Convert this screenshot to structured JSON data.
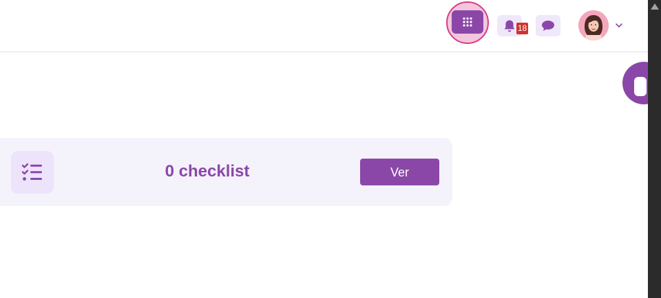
{
  "header": {
    "notifications_count": "18",
    "icons": {
      "apps": "apps-grid-icon",
      "notifications": "bell-icon",
      "messages": "chat-bubble-icon",
      "avatar": "user-avatar",
      "menu": "chevron-down-icon"
    }
  },
  "card": {
    "title": "0 checklist",
    "button_label": "Ver",
    "icon": "checklist-icon"
  },
  "colors": {
    "accent": "#8b47a8",
    "accent_light": "#efe7fa",
    "highlight_ring": "#d63d86",
    "highlight_fill": "#f3c6dc",
    "badge": "#d0332e",
    "card_bg": "#f4f2fa"
  }
}
